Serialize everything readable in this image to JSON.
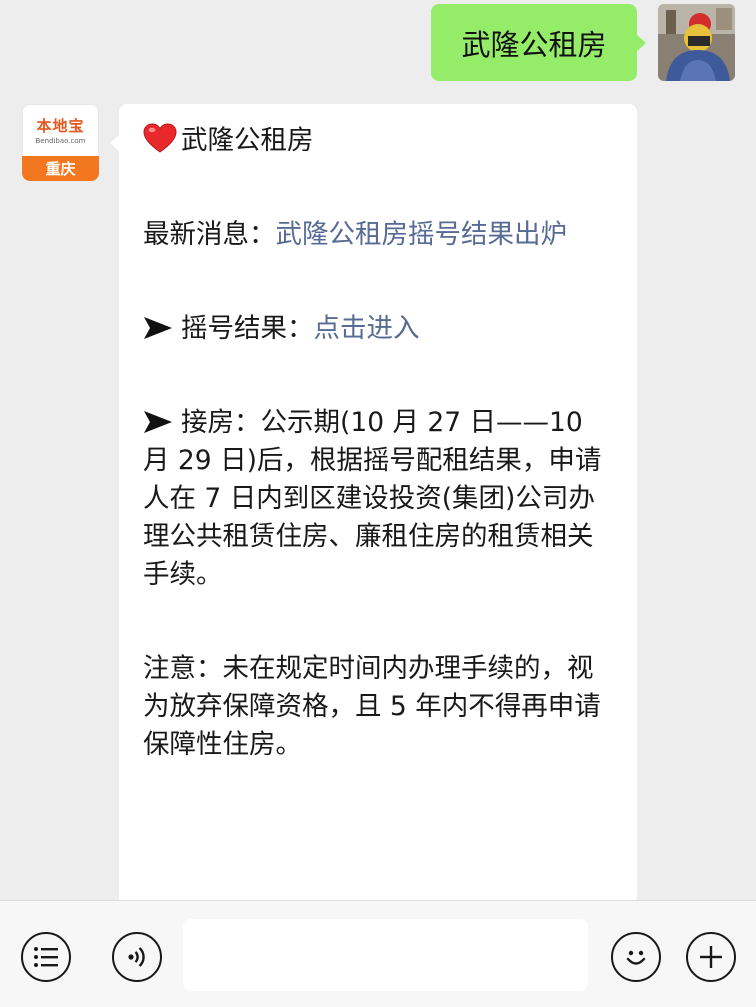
{
  "chat": {
    "outgoing": {
      "text": "武隆公租房"
    },
    "bot": {
      "avatar_logo": "本地宝",
      "avatar_url": "Bendibao.com",
      "avatar_city": "重庆"
    },
    "incoming": {
      "title": "武隆公租房",
      "news_label": "最新消息：",
      "news_link": "武隆公租房摇号结果出炉",
      "result_label": "摇号结果：",
      "result_link": "点击进入",
      "handover": "接房：公示期(10 月 27 日——10 月 29 日)后，根据摇号配租结果，申请人在 7 日内到区建设投资(集团)公司办理公共租赁住房、廉租住房的租赁相关手续。",
      "notice": "注意：未在规定时间内办理手续的，视为放弃保障资格，且 5 年内不得再申请保障性住房。"
    }
  },
  "input_bar": {
    "input_value": "",
    "icons": [
      "menu-icon",
      "voice-icon",
      "emoji-icon",
      "add-icon"
    ]
  },
  "colors": {
    "background": "#ededed",
    "outgoing_bubble": "#95ec69",
    "incoming_bubble": "#ffffff",
    "link": "#576b95",
    "brand_orange": "#f2771f"
  }
}
